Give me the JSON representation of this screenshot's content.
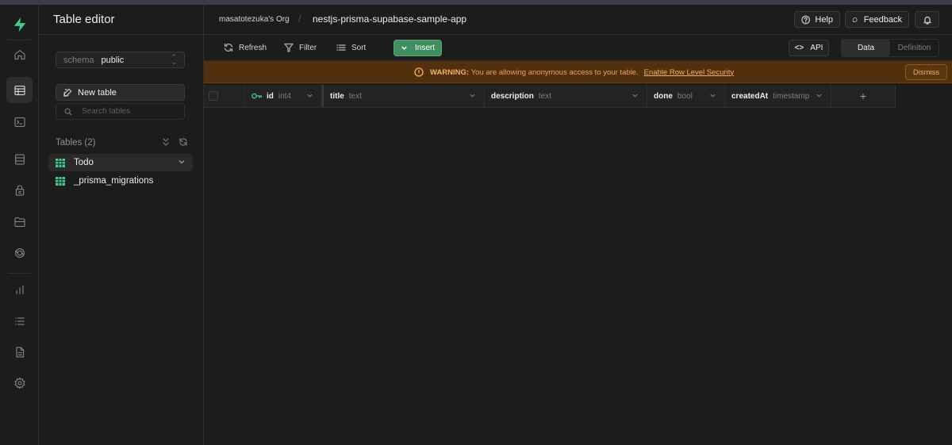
{
  "sidebar": {
    "title": "Table editor",
    "schema_label": "schema",
    "schema_value": "public",
    "new_table_label": "New table",
    "search_placeholder": "Search tables",
    "tables_heading": "Tables (2)",
    "tables": [
      {
        "name": "Todo",
        "active": true
      },
      {
        "name": "_prisma_migrations",
        "active": false
      }
    ]
  },
  "header": {
    "org": "masatotezuka's Org",
    "separator": "/",
    "project": "nestjs-prisma-supabase-sample-app",
    "help_label": "Help",
    "feedback_label": "Feedback"
  },
  "toolbar": {
    "refresh_label": "Refresh",
    "filter_label": "Filter",
    "sort_label": "Sort",
    "insert_label": "Insert",
    "api_label": "API",
    "data_label": "Data",
    "definition_label": "Definition"
  },
  "warning": {
    "title": "WARNING:",
    "message": "You are allowing anonymous access to your table.",
    "link": "Enable Row Level Security",
    "dismiss_label": "Dismiss"
  },
  "grid": {
    "columns": [
      {
        "name": "id",
        "type": "int4",
        "primary_key": true
      },
      {
        "name": "title",
        "type": "text"
      },
      {
        "name": "description",
        "type": "text"
      },
      {
        "name": "done",
        "type": "bool"
      },
      {
        "name": "createdAt",
        "type": "timestamp"
      }
    ],
    "add_column_symbol": "+",
    "rows": []
  },
  "colors": {
    "background": "#1c1c1c",
    "brand_green": "#3ecf8e",
    "insert_button": "#3f8f5f",
    "warning_background": "#52300e",
    "warning_text": "#eaa555"
  },
  "icons": {
    "rail": [
      "supabase-logo-icon",
      "home-icon",
      "table-editor-icon",
      "sql-editor-icon",
      "database-icon",
      "auth-icon",
      "storage-icon",
      "realtime-icon",
      "reports-icon",
      "logs-icon",
      "api-docs-icon",
      "settings-icon"
    ]
  }
}
